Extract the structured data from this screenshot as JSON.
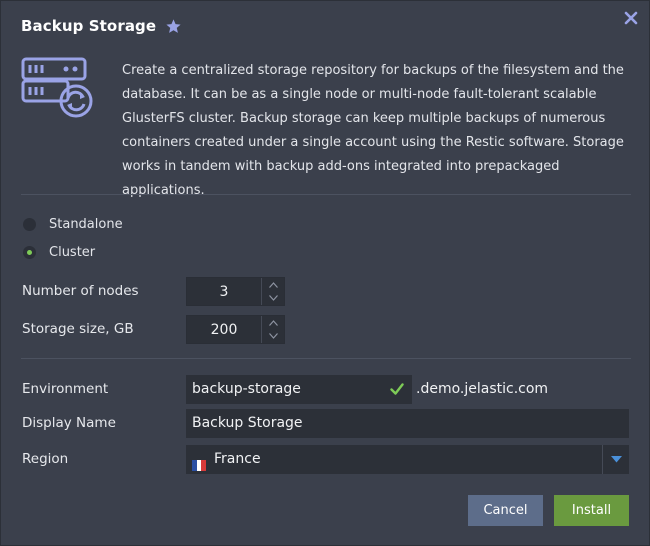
{
  "dialog": {
    "title": "Backup Storage",
    "description": "Create a centralized storage repository for backups of the filesystem and the database. It can be as a single node or multi-node fault-tolerant scalable GlusterFS cluster. Backup storage can keep multiple backups of numerous containers created under a single account using the Restic software. Storage works in tandem with backup add-ons integrated into prepackaged applications."
  },
  "mode": {
    "options": [
      {
        "label": "Standalone",
        "selected": false
      },
      {
        "label": "Cluster",
        "selected": true
      }
    ]
  },
  "nodes": {
    "label": "Number of nodes",
    "value": "3"
  },
  "storage": {
    "label": "Storage size, GB",
    "value": "200"
  },
  "environment": {
    "label": "Environment",
    "value": "backup-storage",
    "suffix": ".demo.jelastic.com"
  },
  "display_name": {
    "label": "Display Name",
    "value": "Backup Storage"
  },
  "region": {
    "label": "Region",
    "value": "France"
  },
  "buttons": {
    "cancel": "Cancel",
    "install": "Install"
  },
  "colors": {
    "background": "#3b404c",
    "accent_green": "#6a9a3f",
    "cancel_blue": "#5d6d8a",
    "icon_purple": "#9aa3e6",
    "check_green": "#7ecb57",
    "dropdown_blue": "#4a90d9"
  },
  "icons": {
    "star": "star-icon",
    "close": "close-icon",
    "app": "server-backup-icon",
    "check": "checkmark-icon",
    "dropdown": "chevron-down-icon",
    "flag": "france-flag-icon"
  }
}
